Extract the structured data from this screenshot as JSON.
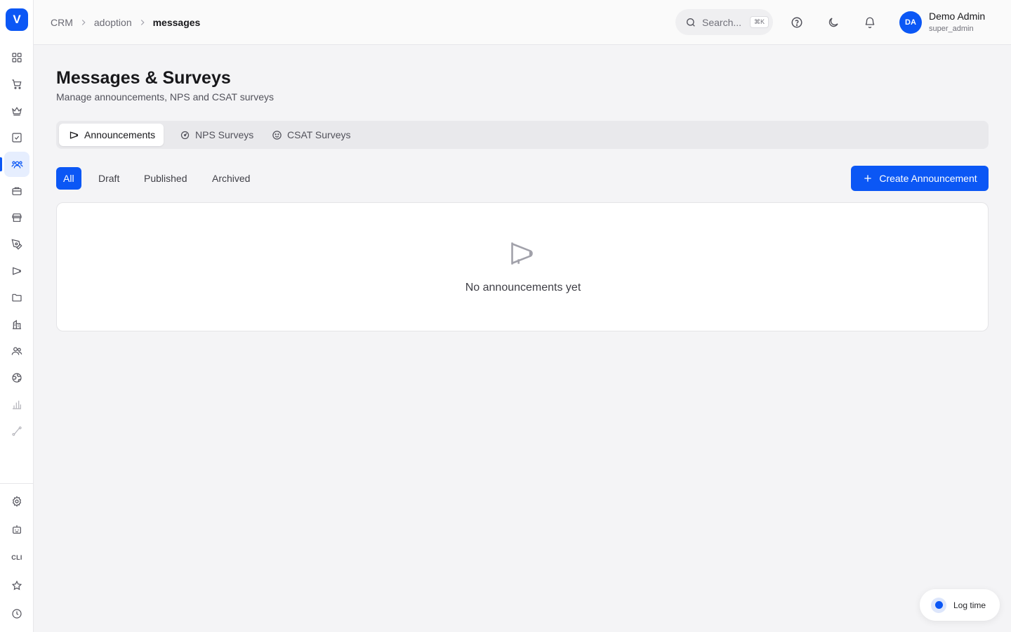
{
  "app": {
    "logo_letter": "V"
  },
  "sidebar": {
    "items": [
      {
        "icon": "dashboard-grid-icon"
      },
      {
        "icon": "cart-icon"
      },
      {
        "icon": "crown-icon"
      },
      {
        "icon": "checkbox-icon"
      },
      {
        "icon": "users-group-icon",
        "active": true
      },
      {
        "icon": "briefcase-icon"
      },
      {
        "icon": "store-icon"
      },
      {
        "icon": "pen-tool-icon"
      },
      {
        "icon": "megaphone-icon"
      },
      {
        "icon": "folder-icon"
      },
      {
        "icon": "building-icon"
      },
      {
        "icon": "team-icon"
      },
      {
        "icon": "globe-icon"
      },
      {
        "icon": "bar-chart-icon"
      },
      {
        "icon": "route-icon"
      }
    ],
    "bottom_items": [
      {
        "icon": "settings-gear-icon"
      },
      {
        "icon": "bot-icon"
      },
      {
        "icon": "cli-icon",
        "label": "CLI"
      },
      {
        "icon": "star-icon"
      },
      {
        "icon": "clock-icon"
      }
    ]
  },
  "header": {
    "breadcrumb": [
      "CRM",
      "adoption",
      "messages"
    ],
    "search": {
      "placeholder": "Search...",
      "shortcut": "⌘K"
    },
    "user": {
      "initials": "DA",
      "name": "Demo Admin",
      "role": "super_admin"
    }
  },
  "page": {
    "title": "Messages & Surveys",
    "subtitle": "Manage announcements, NPS and CSAT surveys"
  },
  "tabs": [
    {
      "label": "Announcements",
      "icon": "megaphone-icon",
      "active": true
    },
    {
      "label": "NPS Surveys",
      "icon": "gauge-icon"
    },
    {
      "label": "CSAT Surveys",
      "icon": "smile-icon"
    }
  ],
  "filters": [
    {
      "label": "All",
      "active": true
    },
    {
      "label": "Draft"
    },
    {
      "label": "Published"
    },
    {
      "label": "Archived"
    }
  ],
  "create_button": {
    "label": "Create Announcement"
  },
  "empty_state": {
    "message": "No announcements yet",
    "icon": "megaphone-icon"
  },
  "log_time": {
    "label": "Log time"
  },
  "colors": {
    "accent": "#0b57f5",
    "background": "#f4f4f6",
    "card": "#ffffff"
  }
}
